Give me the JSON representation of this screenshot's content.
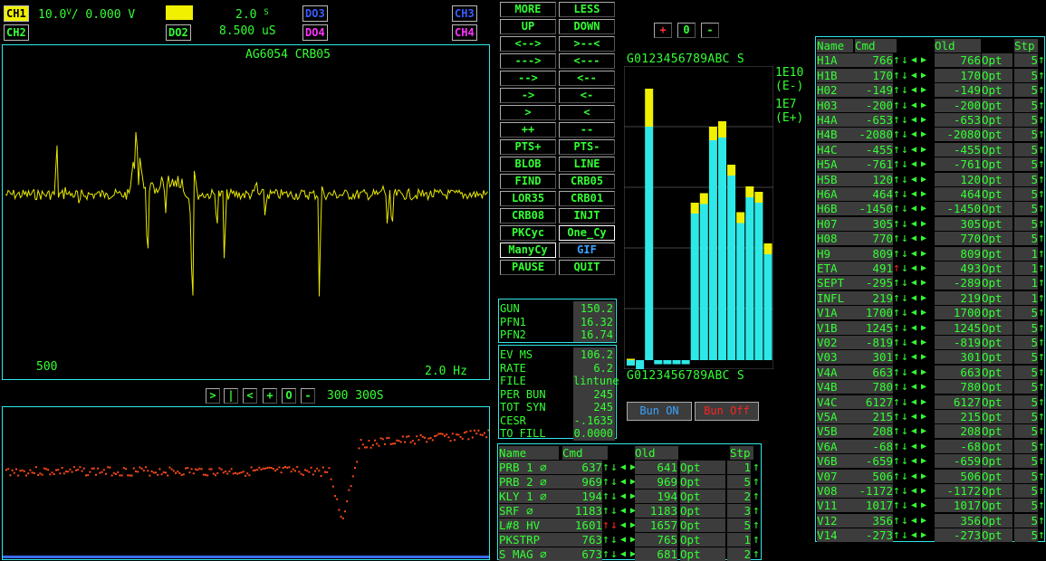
{
  "channels": {
    "ch1": "CH1",
    "ch2": "CH2",
    "ch3": "CH3",
    "ch4": "CH4",
    "do2": "DO2",
    "do3": "DO3",
    "do4": "DO4"
  },
  "readouts": {
    "volts_div": "10.0",
    "volts_unit": "V",
    "volts_sub": "/ 0.000",
    "volts_tail": "V",
    "time_div": "2.0",
    "time_unit": "S",
    "delay": "8.500 uS"
  },
  "scope": {
    "title": "AG6054 CRB05",
    "left_readout": "500",
    "right_readout": "2.0 Hz",
    "trace_color": "#e8e800"
  },
  "history": {
    "controls": [
      ">",
      "|",
      "<",
      "+",
      "O",
      "-"
    ],
    "readout": "300 300S",
    "dot_color": "#ff4a1a"
  },
  "buttons": [
    [
      "MORE",
      "LESS"
    ],
    [
      "UP",
      "DOWN"
    ],
    [
      "<-->",
      ">--<"
    ],
    [
      "--->",
      "<---"
    ],
    [
      "-->",
      "<--"
    ],
    [
      "->",
      "<-"
    ],
    [
      ">",
      "<"
    ],
    [
      "++",
      "--"
    ],
    [
      "PTS+",
      "PTS-"
    ],
    [
      "BLOB",
      "LINE"
    ],
    [
      "FIND",
      "CRB05"
    ],
    [
      "LOR35",
      "CRB01"
    ],
    [
      "CRB08",
      "INJT"
    ],
    [
      "PKCyc",
      "One_Cy"
    ],
    [
      "ManyCy",
      "GIF"
    ],
    [
      "PAUSE",
      "QUIT"
    ]
  ],
  "gun": [
    [
      "GUN",
      "150.2"
    ],
    [
      "PFN1",
      "16.32"
    ],
    [
      "PFN2",
      "16.74"
    ]
  ],
  "stats": [
    [
      "EV MS",
      "106.2"
    ],
    [
      "RATE",
      "6.2"
    ],
    [
      "FILE",
      "lintune"
    ],
    [
      "PER BUN",
      "245"
    ],
    [
      "TOT SYN",
      "245"
    ],
    [
      "CESR",
      "-.1635"
    ],
    [
      "TO FILL",
      "0.0000"
    ]
  ],
  "bar": {
    "controls": [
      "+",
      "0",
      "-"
    ],
    "axis_top": "G0123456789ABC S",
    "axis_bottom": "G0123456789ABC S",
    "scale1": "1E10",
    "scale1b": "(E-)",
    "scale2": "1E7",
    "scale2b": "(E+)",
    "cyan": "#2ee8e8",
    "yellow": "#f0f000",
    "values": [
      {
        "lbl": "G",
        "c": -4,
        "y": 1
      },
      {
        "lbl": "0",
        "c": -8,
        "y": 0
      },
      {
        "lbl": "1",
        "c": 172,
        "y": 28
      },
      {
        "lbl": "2",
        "c": -3,
        "y": 0
      },
      {
        "lbl": "3",
        "c": -3,
        "y": 0
      },
      {
        "lbl": "4",
        "c": -3,
        "y": 0
      },
      {
        "lbl": "5",
        "c": -3,
        "y": 0
      },
      {
        "lbl": "6",
        "c": 108,
        "y": 8
      },
      {
        "lbl": "7",
        "c": 115,
        "y": 8
      },
      {
        "lbl": "8",
        "c": 162,
        "y": 10
      },
      {
        "lbl": "9",
        "c": 164,
        "y": 12
      },
      {
        "lbl": "A",
        "c": 136,
        "y": 8
      },
      {
        "lbl": "B",
        "c": 101,
        "y": 8
      },
      {
        "lbl": "C",
        "c": 120,
        "y": 8
      },
      {
        "lbl": "",
        "c": 116,
        "y": 8
      },
      {
        "lbl": "S",
        "c": 78,
        "y": 8
      }
    ],
    "bun_on": "Bun  ON",
    "bun_off": "Bun Off"
  },
  "mid_table": {
    "headers": {
      "name": "Name",
      "cmd": "Cmd",
      "old": "Old",
      "stp": "Stp"
    },
    "rows": [
      {
        "name": "PRB 1 ∅",
        "cmd": "637",
        "old": "641",
        "opt": "Opt",
        "stp": "1",
        "red": ""
      },
      {
        "name": "PRB 2 ∅",
        "cmd": "969",
        "old": "969",
        "opt": "Opt",
        "stp": "5",
        "red": ""
      },
      {
        "name": "KLY 1 ∅",
        "cmd": "194",
        "old": "194",
        "opt": "Opt",
        "stp": "2",
        "red": ""
      },
      {
        "name": "SRF ∅",
        "cmd": "1183",
        "old": "1183",
        "opt": "Opt",
        "stp": "3",
        "red": ""
      },
      {
        "name": "L#8 HV",
        "cmd": "1601",
        "old": "1657",
        "opt": "Opt",
        "stp": "5",
        "red": "both"
      },
      {
        "name": "PKSTRP",
        "cmd": "763",
        "old": "765",
        "opt": "Opt",
        "stp": "1",
        "red": ""
      },
      {
        "name": "S MAG ∅",
        "cmd": "673",
        "old": "681",
        "opt": "Opt",
        "stp": "2",
        "red": ""
      }
    ]
  },
  "right_table": {
    "headers": {
      "name": "Name",
      "cmd": "Cmd",
      "old": "Old",
      "stp": "Stp"
    },
    "rows": [
      {
        "name": "H1A",
        "cmd": "766",
        "old": "766",
        "opt": "Opt",
        "stp": "5",
        "red": ""
      },
      {
        "name": "H1B",
        "cmd": "170",
        "old": "170",
        "opt": "Opt",
        "stp": "5",
        "red": ""
      },
      {
        "name": "H02",
        "cmd": "-149",
        "old": "-149",
        "opt": "Opt",
        "stp": "5",
        "red": ""
      },
      {
        "name": "H03",
        "cmd": "-200",
        "old": "-200",
        "opt": "Opt",
        "stp": "5",
        "red": ""
      },
      {
        "name": "H4A",
        "cmd": "-653",
        "old": "-653",
        "opt": "Opt",
        "stp": "5",
        "red": ""
      },
      {
        "name": "H4B",
        "cmd": "-2080",
        "old": "-2080",
        "opt": "Opt",
        "stp": "5",
        "red": ""
      },
      {
        "name": "H4C",
        "cmd": "-455",
        "old": "-455",
        "opt": "Opt",
        "stp": "5",
        "red": ""
      },
      {
        "name": "H5A",
        "cmd": "-761",
        "old": "-761",
        "opt": "Opt",
        "stp": "5",
        "red": ""
      },
      {
        "name": "H5B",
        "cmd": "120",
        "old": "120",
        "opt": "Opt",
        "stp": "5",
        "red": ""
      },
      {
        "name": "H6A",
        "cmd": "464",
        "old": "464",
        "opt": "Opt",
        "stp": "5",
        "red": ""
      },
      {
        "name": "H6B",
        "cmd": "-1450",
        "old": "-1450",
        "opt": "Opt",
        "stp": "5",
        "red": ""
      },
      {
        "name": "H07",
        "cmd": "305",
        "old": "305",
        "opt": "Opt",
        "stp": "5",
        "red": ""
      },
      {
        "name": "H08",
        "cmd": "770",
        "old": "770",
        "opt": "Opt",
        "stp": "5",
        "red": ""
      },
      {
        "name": "H9",
        "cmd": "809",
        "old": "809",
        "opt": "Opt",
        "stp": "1",
        "red": ""
      },
      {
        "name": "ETA",
        "cmd": "491",
        "old": "493",
        "opt": "Opt",
        "stp": "1",
        "red": "up"
      },
      {
        "name": "SEPT",
        "cmd": "-295",
        "old": "-289",
        "opt": "Opt",
        "stp": "1",
        "red": ""
      },
      {
        "name": "INFL",
        "cmd": "219",
        "old": "219",
        "opt": "Opt",
        "stp": "1",
        "red": ""
      },
      {
        "name": "V1A",
        "cmd": "1700",
        "old": "1700",
        "opt": "Opt",
        "stp": "5",
        "red": ""
      },
      {
        "name": "V1B",
        "cmd": "1245",
        "old": "1245",
        "opt": "Opt",
        "stp": "5",
        "red": ""
      },
      {
        "name": "V02",
        "cmd": "-819",
        "old": "-819",
        "opt": "Opt",
        "stp": "5",
        "red": ""
      },
      {
        "name": "V03",
        "cmd": "301",
        "old": "301",
        "opt": "Opt",
        "stp": "5",
        "red": ""
      },
      {
        "name": "V4A",
        "cmd": "663",
        "old": "663",
        "opt": "Opt",
        "stp": "5",
        "red": ""
      },
      {
        "name": "V4B",
        "cmd": "780",
        "old": "780",
        "opt": "Opt",
        "stp": "5",
        "red": ""
      },
      {
        "name": "V4C",
        "cmd": "6127",
        "old": "6127",
        "opt": "Opt",
        "stp": "5",
        "red": ""
      },
      {
        "name": "V5A",
        "cmd": "215",
        "old": "215",
        "opt": "Opt",
        "stp": "5",
        "red": ""
      },
      {
        "name": "V5B",
        "cmd": "208",
        "old": "208",
        "opt": "Opt",
        "stp": "5",
        "red": ""
      },
      {
        "name": "V6A",
        "cmd": "-68",
        "old": "-68",
        "opt": "Opt",
        "stp": "5",
        "red": ""
      },
      {
        "name": "V6B",
        "cmd": "-659",
        "old": "-659",
        "opt": "Opt",
        "stp": "5",
        "red": ""
      },
      {
        "name": "V07",
        "cmd": "506",
        "old": "506",
        "opt": "Opt",
        "stp": "5",
        "red": ""
      },
      {
        "name": "V08",
        "cmd": "-1172",
        "old": "-1172",
        "opt": "Opt",
        "stp": "5",
        "red": ""
      },
      {
        "name": "V11",
        "cmd": "1017",
        "old": "1017",
        "opt": "Opt",
        "stp": "5",
        "red": ""
      },
      {
        "name": "V12",
        "cmd": "356",
        "old": "356",
        "opt": "Opt",
        "stp": "5",
        "red": ""
      },
      {
        "name": "V14",
        "cmd": "-273",
        "old": "-273",
        "opt": "Opt",
        "stp": "5",
        "red": ""
      }
    ]
  },
  "icons": {
    "up": "up-arrow-icon",
    "down": "down-arrow-icon",
    "left": "left-triangle-icon",
    "right": "right-triangle-icon"
  }
}
